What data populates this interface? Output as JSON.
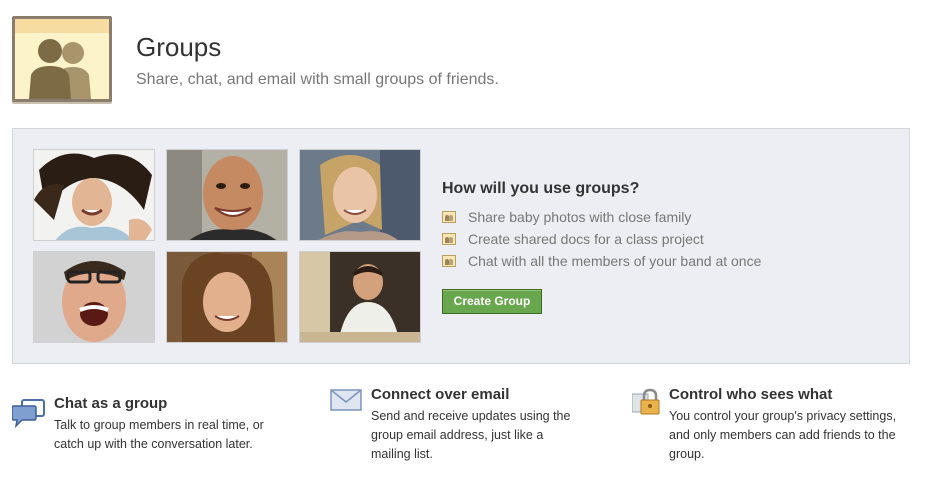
{
  "header": {
    "title": "Groups",
    "subtitle": "Share, chat, and email with small groups of friends.",
    "icon": "groups-silhouette-icon"
  },
  "panel": {
    "photos": [
      "photo-woman-hair-spread",
      "photo-bald-man-smiling",
      "photo-blonde-woman",
      "photo-man-glasses-laughing",
      "photo-curly-hair-man",
      "photo-man-at-table"
    ],
    "heading": "How will you use groups?",
    "uses": [
      "Share baby photos with close family",
      "Create shared docs for a class project",
      "Chat with all the members of your band at once"
    ],
    "create_button": "Create Group"
  },
  "features": [
    {
      "icon": "chat-bubble-icon",
      "title": "Chat as a group",
      "desc_lines": [
        "Talk to group members in real time, or",
        "catch up with the conversation later."
      ]
    },
    {
      "icon": "envelope-icon",
      "title": "Connect over email",
      "desc_lines": [
        "Send and receive updates using the",
        "group email address, just like a",
        "mailing list."
      ]
    },
    {
      "icon": "lock-icon",
      "title": "Control who sees what",
      "desc_lines": [
        "You control your group's privacy settings,",
        "and only members can add friends to the",
        "group."
      ]
    }
  ],
  "colors": {
    "button_green": "#69a74e",
    "panel_bg": "#eceef3",
    "icon_bg": "#fdf3c8"
  }
}
